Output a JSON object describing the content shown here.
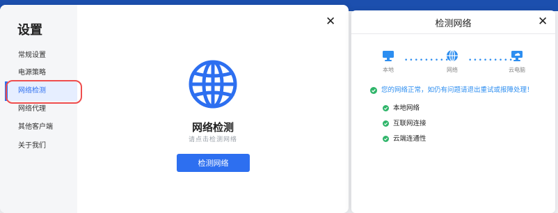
{
  "settings": {
    "title": "设置",
    "menu": [
      {
        "label": "常规设置"
      },
      {
        "label": "电源策略"
      },
      {
        "label": "网络检测"
      },
      {
        "label": "网络代理"
      },
      {
        "label": "其他客户端"
      },
      {
        "label": "关于我们"
      }
    ],
    "active_index": 2,
    "main": {
      "title": "网络检测",
      "subtitle": "请点击检测网络",
      "button_label": "检测网络"
    },
    "close_icon": "close-icon"
  },
  "network_panel": {
    "title": "检测网络",
    "nodes": [
      {
        "label": "本地",
        "icon": "computer-icon"
      },
      {
        "label": "网络",
        "icon": "globe-icon"
      },
      {
        "label": "云电脑",
        "icon": "cloud-computer-icon"
      }
    ],
    "status_message": "您的网络正常，如仍有问题请退出重试或报障处理！",
    "checks": [
      {
        "label": "本地网络"
      },
      {
        "label": "互联网连接"
      },
      {
        "label": "云端连通性"
      }
    ]
  },
  "colors": {
    "accent": "#2d6ff0",
    "success": "#2fb56a",
    "highlight_ring": "#ef4d4d"
  }
}
